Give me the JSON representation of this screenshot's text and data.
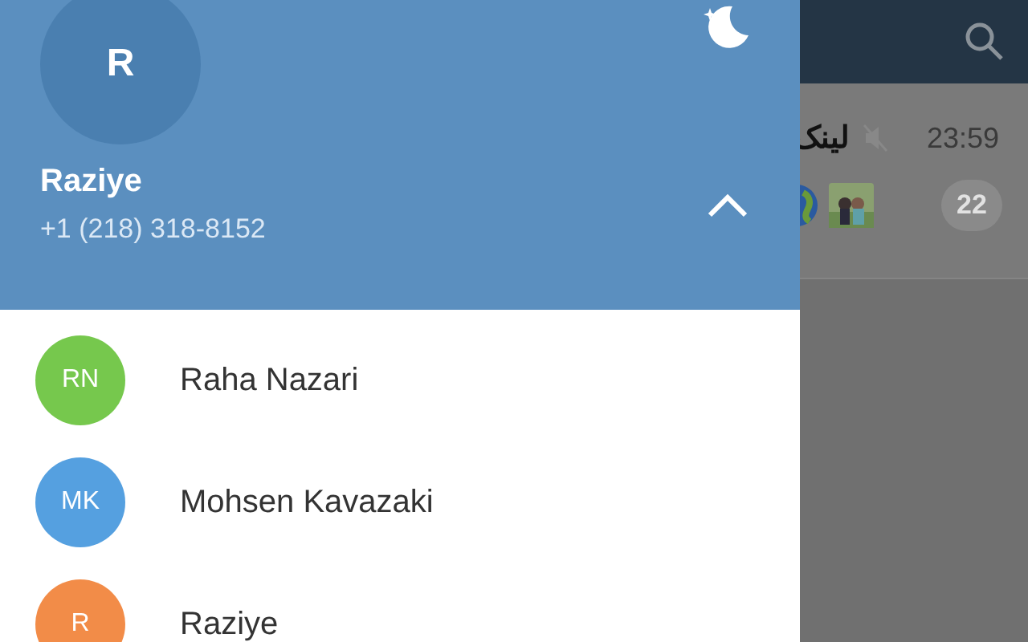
{
  "drawer": {
    "profile": {
      "initial": "R",
      "name": "Raziye",
      "phone": "+1 (218) 318-8152",
      "accounts_expanded": true
    },
    "accounts": [
      {
        "initials": "RN",
        "name": "Raha Nazari",
        "color": "#76c84d"
      },
      {
        "initials": "MK",
        "name": "Mohsen Kavazaki",
        "color": "#55a0e0"
      },
      {
        "initials": "R",
        "name": "Raziye",
        "color": "#f28c48"
      }
    ]
  },
  "chat_list": {
    "chats": [
      {
        "title": "لینک",
        "muted": true,
        "time": "23:59",
        "unread": "22"
      }
    ]
  }
}
